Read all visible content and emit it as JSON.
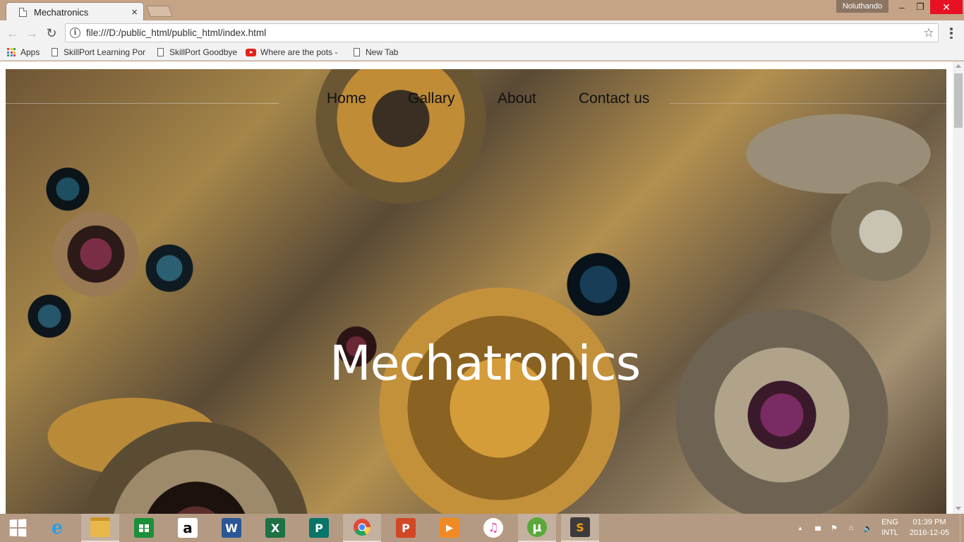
{
  "browser": {
    "tab_title": "Mechatronics",
    "tab_close": "×",
    "user_name": "Noluthando",
    "window_controls": {
      "minimize": "–",
      "maximize": "❐",
      "close": "✕"
    },
    "nav_icons": {
      "back": "←",
      "forward": "→",
      "reload": "↻"
    },
    "address": "file:///D:/public_html/public_html/index.html",
    "info_glyph": "i",
    "star_glyph": "☆",
    "bookmarks": [
      {
        "label": "Apps",
        "icon": "apps-grid-icon"
      },
      {
        "label": "SkillPort Learning Por",
        "icon": "page-icon"
      },
      {
        "label": "SkillPort Goodbye",
        "icon": "page-icon"
      },
      {
        "label": "Where are the pots -",
        "icon": "youtube-icon"
      },
      {
        "label": "New Tab",
        "icon": "page-icon"
      }
    ]
  },
  "page": {
    "nav": [
      "Home",
      "Gallary",
      "About",
      "Contact us"
    ],
    "hero_title": "Mechatronics",
    "background": "clockwork-gears-image"
  },
  "taskbar": {
    "apps": [
      {
        "name": "internet-explorer",
        "glyph": "e",
        "color": "#1e90d8"
      },
      {
        "name": "file-explorer",
        "glyph": "",
        "color": "#e8b84a"
      },
      {
        "name": "store",
        "glyph": "",
        "color": "#1c8f3a"
      },
      {
        "name": "amazon",
        "glyph": "a",
        "color": "#ffffff"
      },
      {
        "name": "word",
        "glyph": "W",
        "color": "#2b5797"
      },
      {
        "name": "excel",
        "glyph": "X",
        "color": "#1e7145"
      },
      {
        "name": "publisher",
        "glyph": "P",
        "color": "#077568"
      },
      {
        "name": "chrome",
        "glyph": "",
        "color": "#dd4b39"
      },
      {
        "name": "powerpoint",
        "glyph": "P",
        "color": "#d24726"
      },
      {
        "name": "media-player",
        "glyph": "▶",
        "color": "#f08a24"
      },
      {
        "name": "itunes",
        "glyph": "♫",
        "color": "#e24aa0"
      },
      {
        "name": "utorrent",
        "glyph": "µ",
        "color": "#5aa83a"
      },
      {
        "name": "sublime-text",
        "glyph": "S",
        "color": "#3b3b3b"
      }
    ],
    "tray_icons": [
      "▲",
      "▮▮▮",
      "⚑",
      "⌂",
      "🔈"
    ],
    "language_line1": "ENG",
    "language_line2": "INTL",
    "time": "01:39 PM",
    "date": "2016-12-05"
  }
}
